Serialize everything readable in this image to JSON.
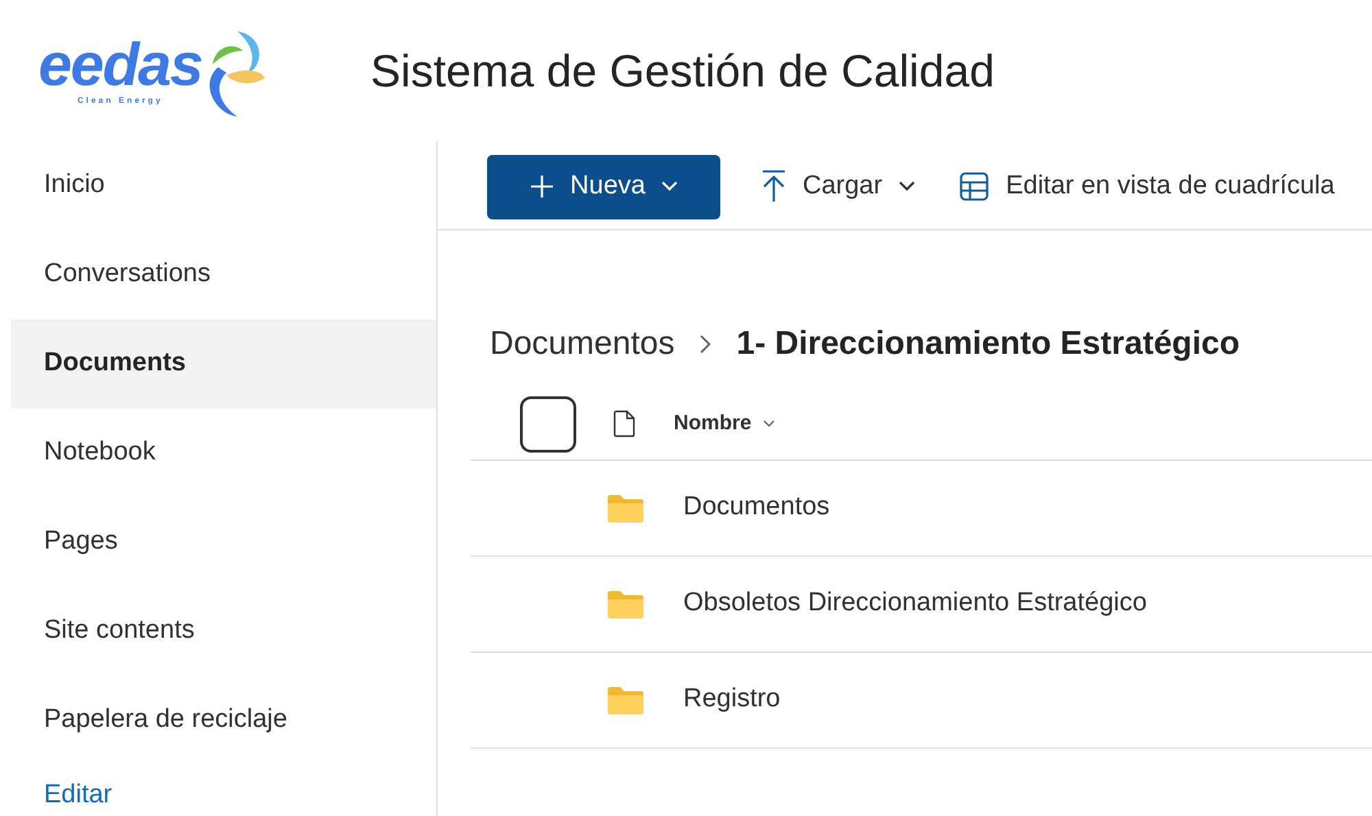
{
  "logo": {
    "name": "eedas",
    "tagline": "Clean Energy"
  },
  "site_title": "Sistema de Gestión de Calidad",
  "nav": [
    {
      "label": "Inicio",
      "selected": false
    },
    {
      "label": "Conversations",
      "selected": false
    },
    {
      "label": "Documents",
      "selected": true
    },
    {
      "label": "Notebook",
      "selected": false
    },
    {
      "label": "Pages",
      "selected": false
    },
    {
      "label": "Site contents",
      "selected": false
    },
    {
      "label": "Papelera de reciclaje",
      "selected": false
    },
    {
      "label": "Editar",
      "kind": "link",
      "selected": false
    }
  ],
  "toolbar": [
    {
      "kind": "new",
      "label": "Nueva"
    },
    {
      "kind": "upload",
      "label": "Cargar"
    },
    {
      "kind": "grid",
      "label": "Editar en vista de cuadrícula"
    }
  ],
  "breadcrumb": [
    {
      "label": "Documentos",
      "current": false
    },
    {
      "label": "1- Direccionamiento Estratégico",
      "current": true
    }
  ],
  "list": {
    "select_all": {
      "checked": false
    },
    "columns": [
      {
        "label": "Nombre"
      }
    ],
    "rows": [
      {
        "name": "Documentos",
        "kind": "folder"
      },
      {
        "name": "Obsoletos Direccionamiento Estratégico",
        "kind": "folder"
      },
      {
        "name": "Registro",
        "kind": "folder"
      }
    ]
  }
}
